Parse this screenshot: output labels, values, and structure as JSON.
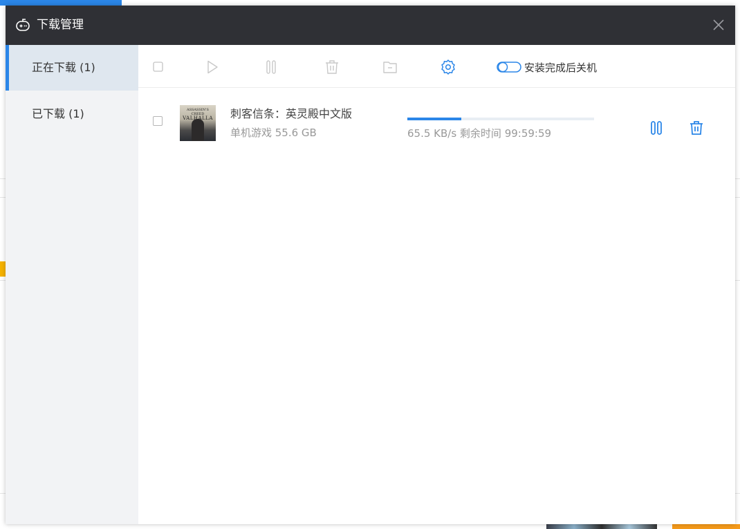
{
  "window": {
    "title": "下载管理"
  },
  "sidebar": {
    "items": [
      {
        "label": "正在下载 (1)",
        "active": true
      },
      {
        "label": "已下载 (1)",
        "active": false
      }
    ]
  },
  "toolbar": {
    "icons": [
      "checkbox",
      "play-icon",
      "pause-icon",
      "delete-icon",
      "folder-icon",
      "settings-icon"
    ],
    "shutdown_toggle_label": "安装完成后关机",
    "shutdown_toggle_on": false
  },
  "downloads": [
    {
      "title": "刺客信条：英灵殿中文版",
      "meta": "单机游戏 55.6 GB",
      "cover_text_top": "ASSASSIN'S CREED",
      "cover_text_main": "VALHALLA",
      "progress": 0.29,
      "status": "65.5 KB/s 剩余时间 99:59:59"
    }
  ],
  "colors": {
    "accent": "#2b86e8",
    "titlebar": "#2f3035",
    "sidebar_bg": "#f2f3f5",
    "sidebar_active_bg": "#dfe7ef"
  }
}
